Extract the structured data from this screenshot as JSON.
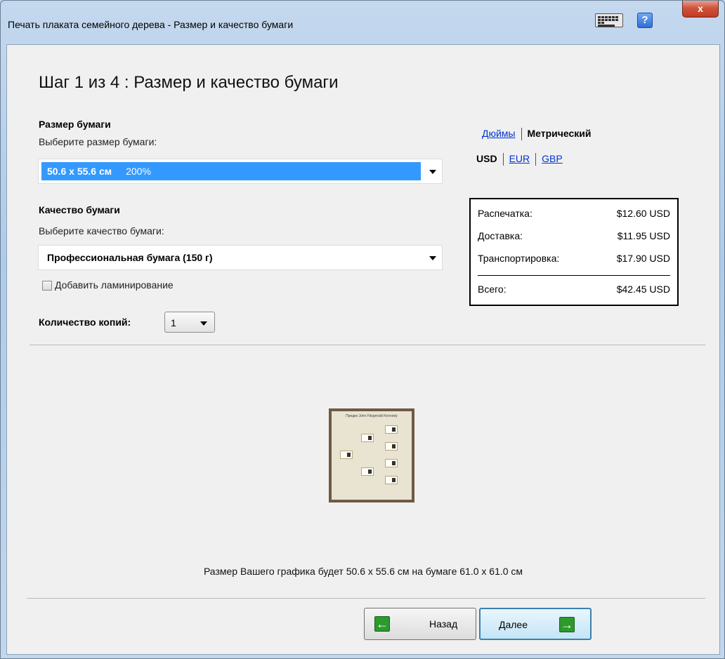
{
  "window": {
    "title": "Печать плаката семейного дерева - Размер и качество бумаги",
    "close_glyph": "x",
    "help_glyph": "?"
  },
  "step": {
    "heading": "Шаг 1 из 4 : Размер и качество бумаги"
  },
  "paper_size": {
    "section_label": "Размер бумаги",
    "prompt": "Выберите размер бумаги:",
    "selected_value": "50.6 x 55.6 см",
    "selected_percent": "200%"
  },
  "paper_quality": {
    "section_label": "Качество бумаги",
    "prompt": "Выберите качество бумаги:",
    "selected_value": "Профессиональная бумага (150 г)",
    "lamination_label": "Добавить ламинирование",
    "lamination_checked": false
  },
  "copies": {
    "label": "Количество копий:",
    "value": "1"
  },
  "units": {
    "inches": "Дюймы",
    "metric": "Метрический",
    "active": "metric"
  },
  "currency": {
    "usd": "USD",
    "eur": "EUR",
    "gbp": "GBP",
    "active": "usd"
  },
  "prices": {
    "rows": [
      {
        "label": "Распечатка:",
        "value": "$12.60 USD"
      },
      {
        "label": "Доставка:",
        "value": "$11.95 USD"
      },
      {
        "label": "Транспортировка:",
        "value": "$17.90 USD"
      }
    ],
    "total_label": "Всего:",
    "total_value": "$42.45 USD"
  },
  "preview": {
    "title": "Предки John Fitzgerald Kennedy",
    "caption": "Размер Вашего графика будет 50.6 x 55.6 см на бумаге 61.0 x 61.0 см"
  },
  "buttons": {
    "back": "Назад",
    "next": "Далее"
  },
  "colors": {
    "selection": "#3399ff",
    "link": "#0033cc",
    "arrow_green": "#2c9a2c"
  },
  "icons": [
    "keyboard-icon",
    "help-icon",
    "close-icon",
    "arrow-left-icon",
    "arrow-right-icon",
    "chevron-down-icon"
  ]
}
